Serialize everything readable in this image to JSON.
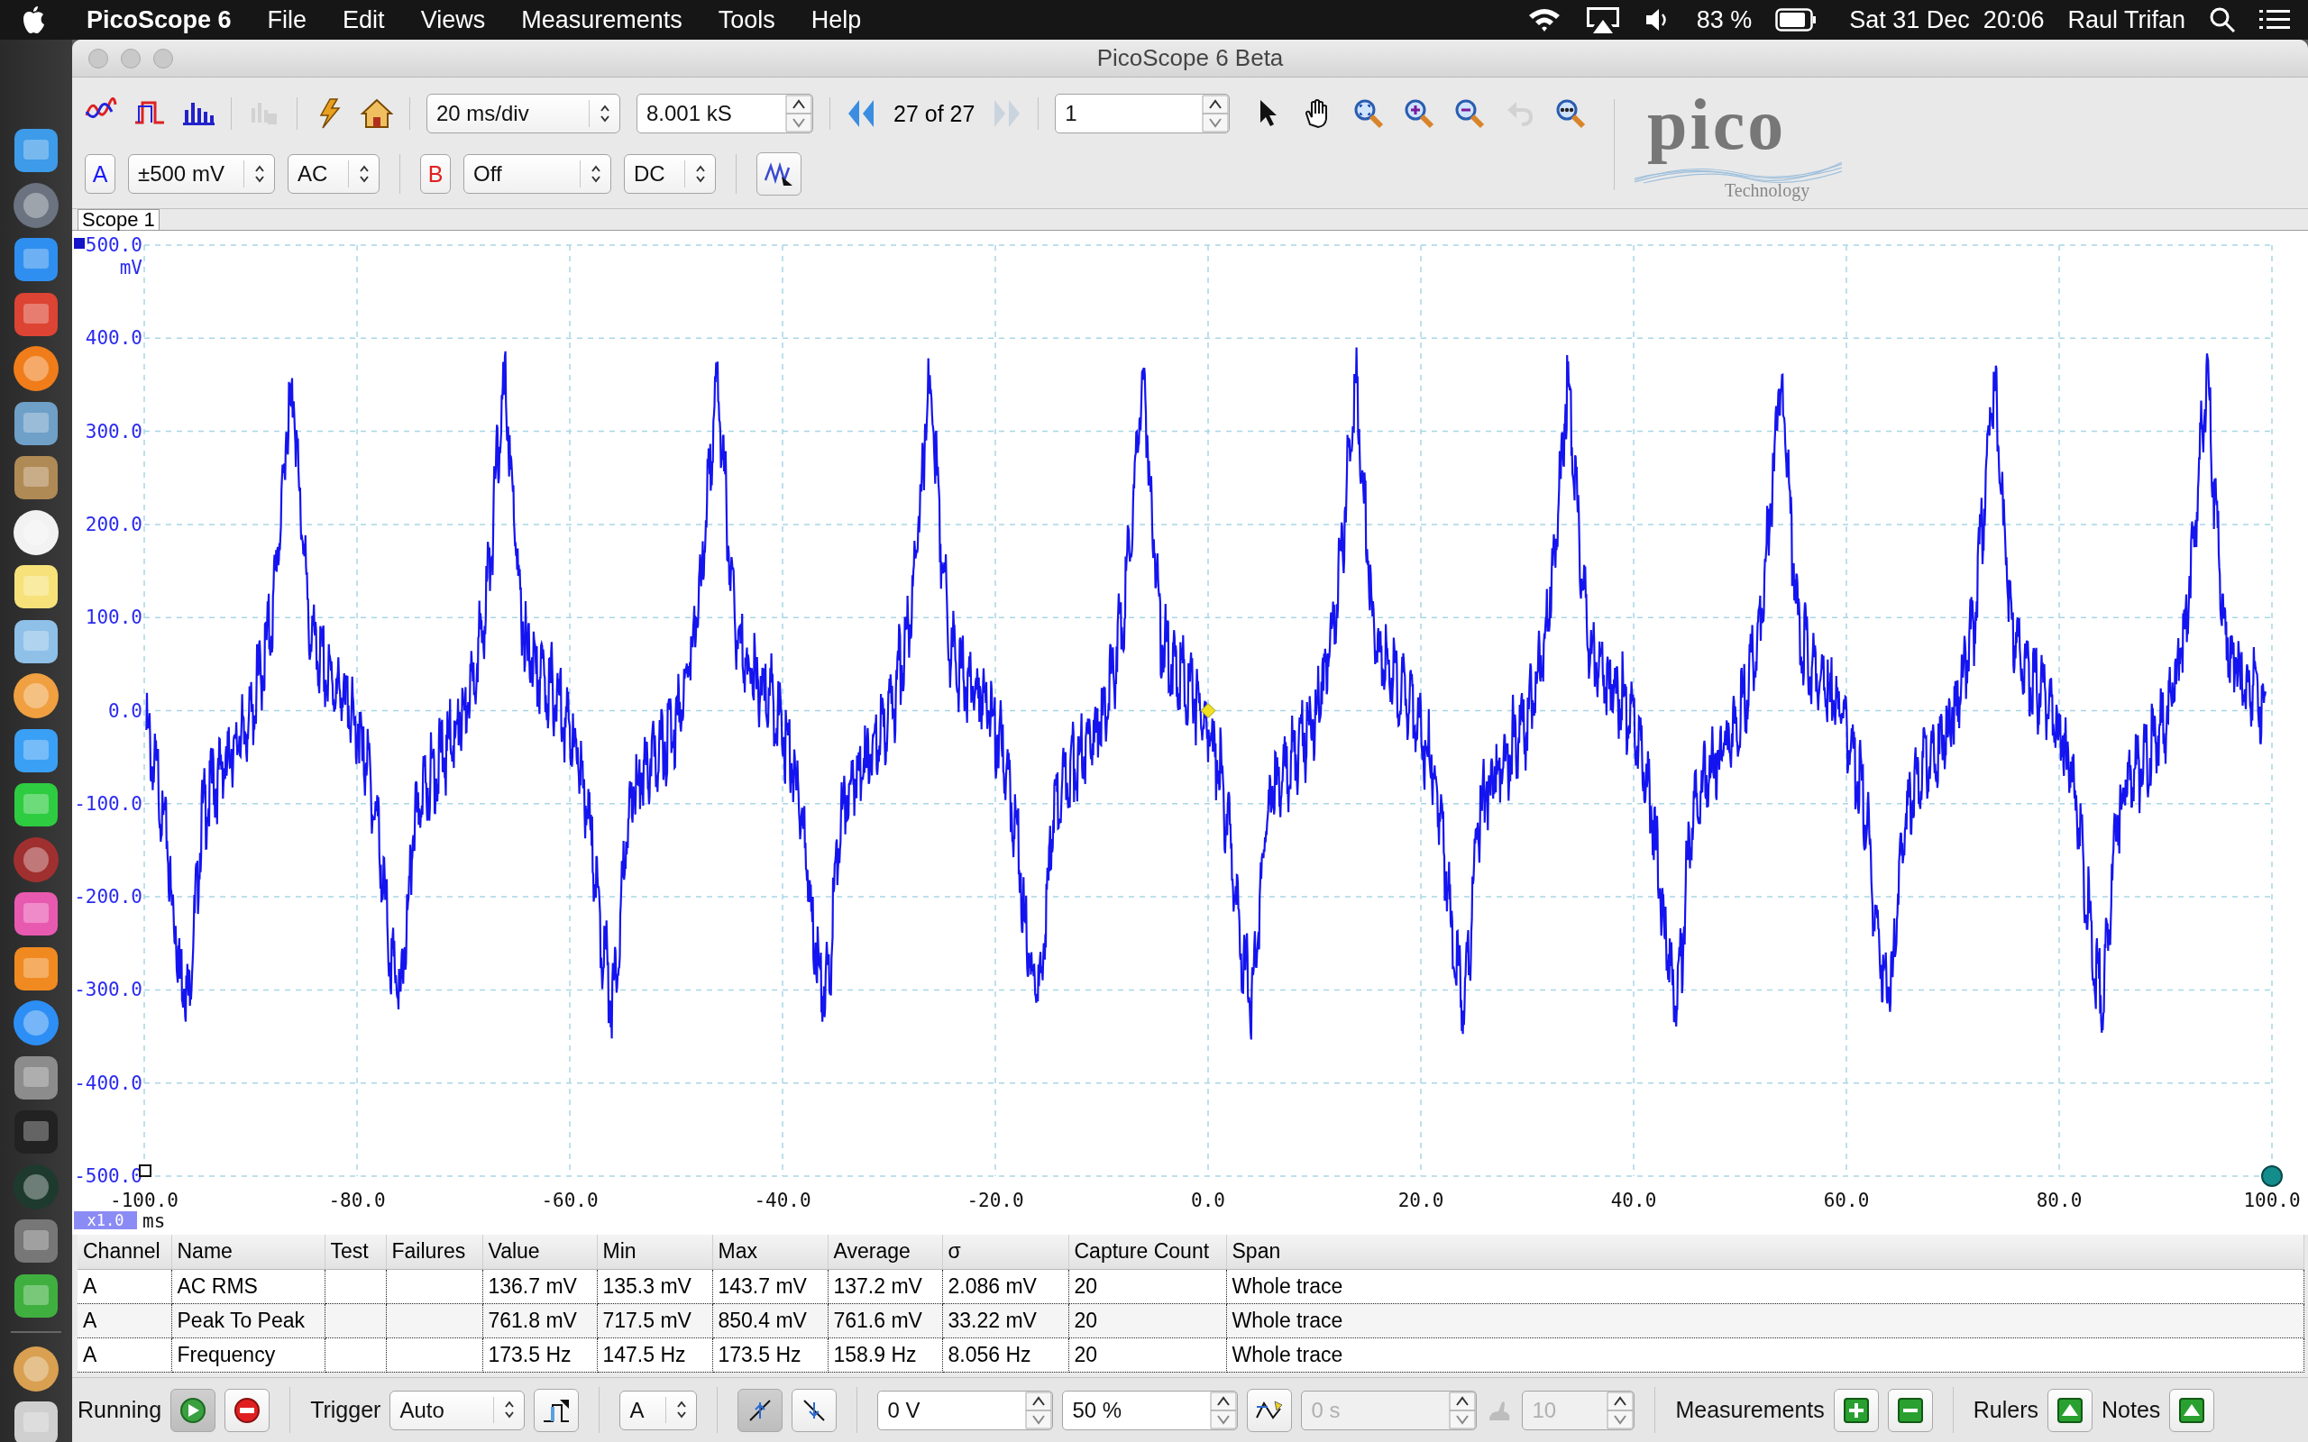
{
  "menu_bar": {
    "app": "PicoScope 6",
    "menus": [
      "File",
      "Edit",
      "Views",
      "Measurements",
      "Tools",
      "Help"
    ],
    "battery": "83 %",
    "clock": "Sat 31 Dec  20:06",
    "user": "Raul Trifan"
  },
  "dock": {
    "apps": [
      {
        "color": "#3d9be9"
      },
      {
        "color": "#6b7380"
      },
      {
        "color": "#2f8ff0"
      },
      {
        "color": "#dd4433"
      },
      {
        "color": "#f07d1a"
      },
      {
        "color": "#6fa0c8"
      },
      {
        "color": "#b08a55"
      },
      {
        "color": "#f2f2f2"
      },
      {
        "color": "#f7e27a"
      },
      {
        "color": "#8fc0e8"
      },
      {
        "color": "#f0a040"
      },
      {
        "color": "#3aa0f5"
      },
      {
        "color": "#2ecc40"
      },
      {
        "color": "#a03030"
      },
      {
        "color": "#e85ab0"
      },
      {
        "color": "#f08a20"
      },
      {
        "color": "#2d8ff5"
      },
      {
        "color": "#8c8c8c"
      },
      {
        "color": "#222222"
      },
      {
        "color": "#1e3a2e"
      },
      {
        "color": "#777777"
      },
      {
        "color": "#3fb040"
      },
      {
        "color": "#d8a050"
      },
      {
        "color": "#cfcfcf"
      }
    ]
  },
  "window": {
    "title": "PicoScope 6 Beta"
  },
  "toolbar": {
    "modes": [
      {
        "kind": "scope",
        "disabled": false
      },
      {
        "kind": "persistence",
        "disabled": false
      },
      {
        "kind": "spectrum",
        "disabled": false
      },
      {
        "kind": "hand-chart",
        "disabled": true
      }
    ],
    "timebase": "20 ms/div",
    "samples": "8.001 kS",
    "buffer": "27 of 27",
    "capture": "1",
    "tools": [
      {
        "kind": "pointer",
        "disabled": false
      },
      {
        "kind": "hand",
        "disabled": false
      },
      {
        "kind": "zoom-fit",
        "disabled": false
      },
      {
        "kind": "zoom-in",
        "disabled": false
      },
      {
        "kind": "zoom-out",
        "disabled": false
      },
      {
        "kind": "undo",
        "disabled": true
      },
      {
        "kind": "zoom-100",
        "disabled": false
      }
    ],
    "logo": {
      "wordmark": "pico",
      "tagline": "Technology"
    }
  },
  "channels": [
    {
      "label": "A",
      "range": "±500 mV",
      "coupling": "AC",
      "color": "#1a1aff"
    },
    {
      "label": "B",
      "range": "Off",
      "coupling": "DC",
      "color": "#e02020"
    }
  ],
  "scope": {
    "tab": "Scope 1",
    "y_unit": "mV",
    "y_labels": [
      "500.0",
      "400.0",
      "300.0",
      "200.0",
      "100.0",
      "0.0",
      "-100.0",
      "-200.0",
      "-300.0",
      "-400.0",
      "-500.0"
    ],
    "x_labels": [
      "-100.0",
      "-80.0",
      "-60.0",
      "-40.0",
      "-20.0",
      "0.0",
      "20.0",
      "40.0",
      "60.0",
      "80.0",
      "100.0"
    ],
    "x_unit": "ms",
    "zoom": "x1.0"
  },
  "measurements": {
    "columns": [
      "Channel",
      "Name",
      "Test",
      "Failures",
      "Value",
      "Min",
      "Max",
      "Average",
      "σ",
      "Capture Count",
      "Span"
    ],
    "rows": [
      {
        "channel": "A",
        "name": "AC RMS",
        "value": "136.7 mV",
        "min": "135.3 mV",
        "max": "143.7 mV",
        "average": "137.2 mV",
        "sigma": "2.086 mV",
        "capture_count": "20",
        "span": "Whole trace"
      },
      {
        "channel": "A",
        "name": "Peak To Peak",
        "value": "761.8 mV",
        "min": "717.5 mV",
        "max": "850.4 mV",
        "average": "761.6 mV",
        "sigma": "33.22 mV",
        "capture_count": "20",
        "span": "Whole trace"
      },
      {
        "channel": "A",
        "name": "Frequency",
        "value": "173.5 Hz",
        "min": "147.5 Hz",
        "max": "173.5 Hz",
        "average": "158.9 Hz",
        "sigma": "8.056 Hz",
        "capture_count": "20",
        "span": "Whole trace"
      }
    ]
  },
  "bottom_bar": {
    "status": "Running",
    "running": true,
    "trigger_label": "Trigger",
    "trigger_mode": "Auto",
    "trigger_channel": "A",
    "edges": [
      {
        "kind": "rising",
        "selected": true
      },
      {
        "kind": "falling",
        "selected": false
      }
    ],
    "threshold": "0 V",
    "pretrigger": "50 %",
    "delay": {
      "value": "0 s",
      "disabled": true
    },
    "count": {
      "value": "10",
      "disabled": true
    },
    "measurements_label": "Measurements",
    "rulers_label": "Rulers",
    "notes_label": "Notes"
  }
}
